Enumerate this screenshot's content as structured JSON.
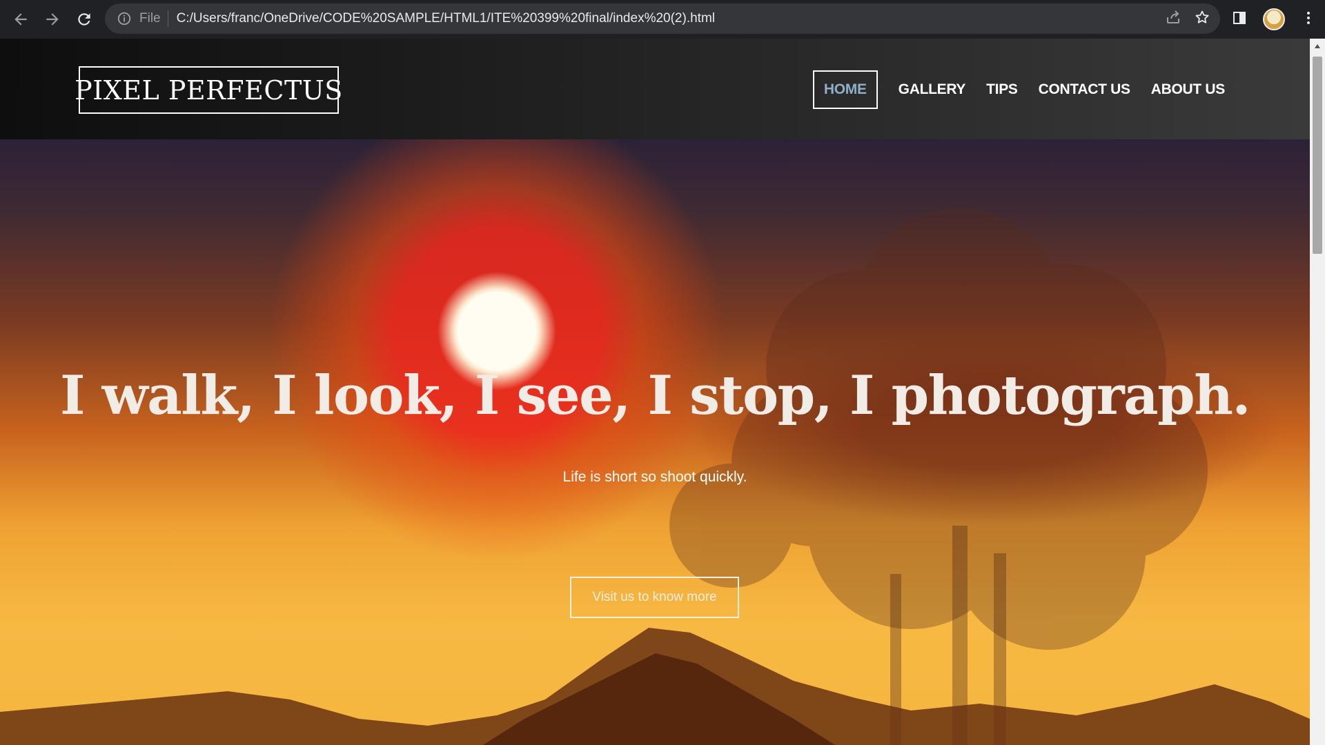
{
  "browser": {
    "scheme_label": "File",
    "url": "C:/Users/franc/OneDrive/CODE%20SAMPLE/HTML1/ITE%20399%20final/index%20(2).html",
    "icons": [
      "back-icon",
      "forward-icon",
      "reload-icon",
      "info-icon",
      "share-icon",
      "star-icon",
      "side-panel-icon",
      "profile-avatar",
      "menu-icon"
    ]
  },
  "site": {
    "logo": "PIXEL PERFECTUS",
    "nav": [
      {
        "label": "HOME",
        "active": true
      },
      {
        "label": "GALLERY",
        "active": false
      },
      {
        "label": "TIPS",
        "active": false
      },
      {
        "label": "CONTACT US",
        "active": false
      },
      {
        "label": "ABOUT US",
        "active": false
      }
    ]
  },
  "hero": {
    "headline": "I walk, I look, I see, I stop, I photograph.",
    "tagline": "Life is short so shoot quickly.",
    "cta_label": "Visit us to know more"
  },
  "colors": {
    "chrome_bg": "#202124",
    "omnibox_bg": "#35363a",
    "active_nav": "#8fb0c8",
    "header_bg": "#1b1b1b"
  }
}
